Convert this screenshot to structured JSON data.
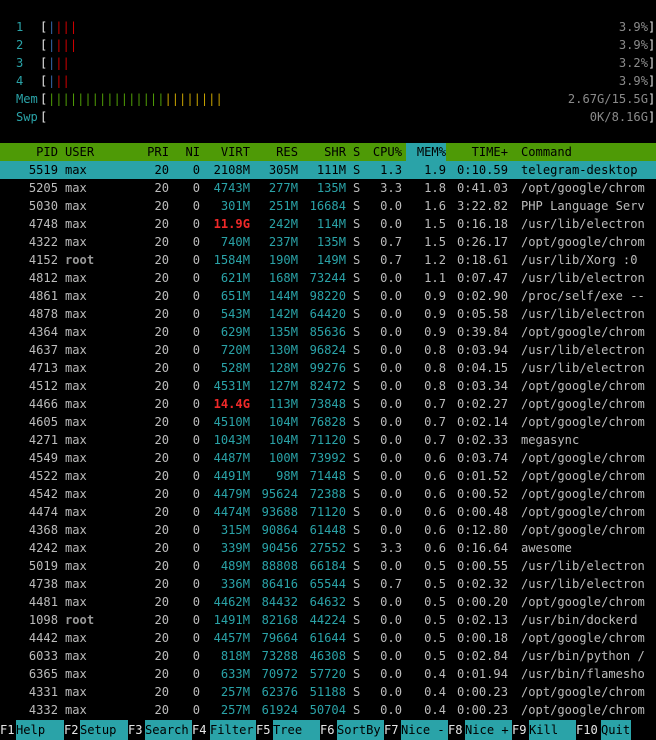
{
  "cpus": [
    {
      "label": "1",
      "percent": "3.9%",
      "low": "|",
      "normal": "|||"
    },
    {
      "label": "2",
      "percent": "3.9%",
      "low": "|",
      "normal": "|||"
    },
    {
      "label": "3",
      "percent": "3.2%",
      "low": "|",
      "normal": "||"
    },
    {
      "label": "4",
      "percent": "3.9%",
      "low": "|",
      "normal": "||"
    }
  ],
  "mem": {
    "label": "Mem",
    "value": "2.67G/15.5G",
    "used": "||||||||||||||||",
    "buffers": "",
    "cache": "||||||||"
  },
  "swp": {
    "label": "Swp",
    "value": "0K/8.16G"
  },
  "header": {
    "pid": "PID",
    "user": "USER",
    "pri": "PRI",
    "ni": "NI",
    "virt": "VIRT",
    "res": "RES",
    "shr": "SHR",
    "s": "S",
    "cpu": "CPU%",
    "mem": "MEM%",
    "time": "TIME+",
    "command": "Command"
  },
  "processes": [
    {
      "pid": "5519",
      "user": "max",
      "pri": "20",
      "ni": "0",
      "virt": "2108M",
      "res": "305M",
      "shr": "111M",
      "s": "S",
      "cpu": "1.3",
      "mem": "1.9",
      "time": "0:10.59",
      "command": "telegram-desktop",
      "selected": true
    },
    {
      "pid": "5205",
      "user": "max",
      "pri": "20",
      "ni": "0",
      "virt": "4743M",
      "res": "277M",
      "shr": "135M",
      "s": "S",
      "cpu": "3.3",
      "mem": "1.8",
      "time": "0:41.03",
      "command": "/opt/google/chrom"
    },
    {
      "pid": "5030",
      "user": "max",
      "pri": "20",
      "ni": "0",
      "virt": "301M",
      "res": "251M",
      "shr": "16684",
      "s": "S",
      "cpu": "0.0",
      "mem": "1.6",
      "time": "3:22.82",
      "command": "PHP Language Serv"
    },
    {
      "pid": "4748",
      "user": "max",
      "pri": "20",
      "ni": "0",
      "virt": "11.9G",
      "res": "242M",
      "shr": "114M",
      "s": "S",
      "cpu": "0.0",
      "mem": "1.5",
      "time": "0:16.18",
      "command": "/usr/lib/electron",
      "bigvirt": true
    },
    {
      "pid": "4322",
      "user": "max",
      "pri": "20",
      "ni": "0",
      "virt": "740M",
      "res": "237M",
      "shr": "135M",
      "s": "S",
      "cpu": "0.7",
      "mem": "1.5",
      "time": "0:26.17",
      "command": "/opt/google/chrom"
    },
    {
      "pid": "4152",
      "user": "root",
      "pri": "20",
      "ni": "0",
      "virt": "1584M",
      "res": "190M",
      "shr": "149M",
      "s": "S",
      "cpu": "0.7",
      "mem": "1.2",
      "time": "0:18.61",
      "command": "/usr/lib/Xorg :0"
    },
    {
      "pid": "4812",
      "user": "max",
      "pri": "20",
      "ni": "0",
      "virt": "621M",
      "res": "168M",
      "shr": "73244",
      "s": "S",
      "cpu": "0.0",
      "mem": "1.1",
      "time": "0:07.47",
      "command": "/usr/lib/electron"
    },
    {
      "pid": "4861",
      "user": "max",
      "pri": "20",
      "ni": "0",
      "virt": "651M",
      "res": "144M",
      "shr": "98220",
      "s": "S",
      "cpu": "0.0",
      "mem": "0.9",
      "time": "0:02.90",
      "command": "/proc/self/exe --"
    },
    {
      "pid": "4878",
      "user": "max",
      "pri": "20",
      "ni": "0",
      "virt": "543M",
      "res": "142M",
      "shr": "64420",
      "s": "S",
      "cpu": "0.0",
      "mem": "0.9",
      "time": "0:05.58",
      "command": "/usr/lib/electron"
    },
    {
      "pid": "4364",
      "user": "max",
      "pri": "20",
      "ni": "0",
      "virt": "629M",
      "res": "135M",
      "shr": "85636",
      "s": "S",
      "cpu": "0.0",
      "mem": "0.9",
      "time": "0:39.84",
      "command": "/opt/google/chrom"
    },
    {
      "pid": "4637",
      "user": "max",
      "pri": "20",
      "ni": "0",
      "virt": "720M",
      "res": "130M",
      "shr": "96824",
      "s": "S",
      "cpu": "0.0",
      "mem": "0.8",
      "time": "0:03.94",
      "command": "/usr/lib/electron"
    },
    {
      "pid": "4713",
      "user": "max",
      "pri": "20",
      "ni": "0",
      "virt": "528M",
      "res": "128M",
      "shr": "99276",
      "s": "S",
      "cpu": "0.0",
      "mem": "0.8",
      "time": "0:04.15",
      "command": "/usr/lib/electron"
    },
    {
      "pid": "4512",
      "user": "max",
      "pri": "20",
      "ni": "0",
      "virt": "4531M",
      "res": "127M",
      "shr": "82472",
      "s": "S",
      "cpu": "0.0",
      "mem": "0.8",
      "time": "0:03.34",
      "command": "/opt/google/chrom"
    },
    {
      "pid": "4466",
      "user": "max",
      "pri": "20",
      "ni": "0",
      "virt": "14.4G",
      "res": "113M",
      "shr": "73848",
      "s": "S",
      "cpu": "0.0",
      "mem": "0.7",
      "time": "0:02.27",
      "command": "/opt/google/chrom",
      "bigvirt": true
    },
    {
      "pid": "4605",
      "user": "max",
      "pri": "20",
      "ni": "0",
      "virt": "4510M",
      "res": "104M",
      "shr": "76828",
      "s": "S",
      "cpu": "0.0",
      "mem": "0.7",
      "time": "0:02.14",
      "command": "/opt/google/chrom"
    },
    {
      "pid": "4271",
      "user": "max",
      "pri": "20",
      "ni": "0",
      "virt": "1043M",
      "res": "104M",
      "shr": "71120",
      "s": "S",
      "cpu": "0.0",
      "mem": "0.7",
      "time": "0:02.33",
      "command": "megasync"
    },
    {
      "pid": "4549",
      "user": "max",
      "pri": "20",
      "ni": "0",
      "virt": "4487M",
      "res": "100M",
      "shr": "73992",
      "s": "S",
      "cpu": "0.0",
      "mem": "0.6",
      "time": "0:03.74",
      "command": "/opt/google/chrom"
    },
    {
      "pid": "4522",
      "user": "max",
      "pri": "20",
      "ni": "0",
      "virt": "4491M",
      "res": "98M",
      "shr": "71448",
      "s": "S",
      "cpu": "0.0",
      "mem": "0.6",
      "time": "0:01.52",
      "command": "/opt/google/chrom"
    },
    {
      "pid": "4542",
      "user": "max",
      "pri": "20",
      "ni": "0",
      "virt": "4479M",
      "res": "95624",
      "shr": "72388",
      "s": "S",
      "cpu": "0.0",
      "mem": "0.6",
      "time": "0:00.52",
      "command": "/opt/google/chrom"
    },
    {
      "pid": "4474",
      "user": "max",
      "pri": "20",
      "ni": "0",
      "virt": "4474M",
      "res": "93688",
      "shr": "71120",
      "s": "S",
      "cpu": "0.0",
      "mem": "0.6",
      "time": "0:00.48",
      "command": "/opt/google/chrom"
    },
    {
      "pid": "4368",
      "user": "max",
      "pri": "20",
      "ni": "0",
      "virt": "315M",
      "res": "90864",
      "shr": "61448",
      "s": "S",
      "cpu": "0.0",
      "mem": "0.6",
      "time": "0:12.80",
      "command": "/opt/google/chrom"
    },
    {
      "pid": "4242",
      "user": "max",
      "pri": "20",
      "ni": "0",
      "virt": "339M",
      "res": "90456",
      "shr": "27552",
      "s": "S",
      "cpu": "3.3",
      "mem": "0.6",
      "time": "0:16.64",
      "command": "awesome"
    },
    {
      "pid": "5019",
      "user": "max",
      "pri": "20",
      "ni": "0",
      "virt": "489M",
      "res": "88808",
      "shr": "66184",
      "s": "S",
      "cpu": "0.0",
      "mem": "0.5",
      "time": "0:00.55",
      "command": "/usr/lib/electron"
    },
    {
      "pid": "4738",
      "user": "max",
      "pri": "20",
      "ni": "0",
      "virt": "336M",
      "res": "86416",
      "shr": "65544",
      "s": "S",
      "cpu": "0.7",
      "mem": "0.5",
      "time": "0:02.32",
      "command": "/usr/lib/electron"
    },
    {
      "pid": "4481",
      "user": "max",
      "pri": "20",
      "ni": "0",
      "virt": "4462M",
      "res": "84432",
      "shr": "64632",
      "s": "S",
      "cpu": "0.0",
      "mem": "0.5",
      "time": "0:00.20",
      "command": "/opt/google/chrom"
    },
    {
      "pid": "1098",
      "user": "root",
      "pri": "20",
      "ni": "0",
      "virt": "1491M",
      "res": "82168",
      "shr": "44224",
      "s": "S",
      "cpu": "0.0",
      "mem": "0.5",
      "time": "0:02.13",
      "command": "/usr/bin/dockerd"
    },
    {
      "pid": "4442",
      "user": "max",
      "pri": "20",
      "ni": "0",
      "virt": "4457M",
      "res": "79664",
      "shr": "61644",
      "s": "S",
      "cpu": "0.0",
      "mem": "0.5",
      "time": "0:00.18",
      "command": "/opt/google/chrom"
    },
    {
      "pid": "6033",
      "user": "max",
      "pri": "20",
      "ni": "0",
      "virt": "818M",
      "res": "73288",
      "shr": "46308",
      "s": "S",
      "cpu": "0.0",
      "mem": "0.5",
      "time": "0:02.84",
      "command": "/usr/bin/python /"
    },
    {
      "pid": "6365",
      "user": "max",
      "pri": "20",
      "ni": "0",
      "virt": "633M",
      "res": "70972",
      "shr": "57720",
      "s": "S",
      "cpu": "0.0",
      "mem": "0.4",
      "time": "0:01.94",
      "command": "/usr/bin/flamesho"
    },
    {
      "pid": "4331",
      "user": "max",
      "pri": "20",
      "ni": "0",
      "virt": "257M",
      "res": "62376",
      "shr": "51188",
      "s": "S",
      "cpu": "0.0",
      "mem": "0.4",
      "time": "0:00.23",
      "command": "/opt/google/chrom"
    },
    {
      "pid": "4332",
      "user": "max",
      "pri": "20",
      "ni": "0",
      "virt": "257M",
      "res": "61924",
      "shr": "50704",
      "s": "S",
      "cpu": "0.0",
      "mem": "0.4",
      "time": "0:00.23",
      "command": "/opt/google/chrom"
    }
  ],
  "footer": [
    {
      "key": "F1",
      "label": "Help"
    },
    {
      "key": "F2",
      "label": "Setup"
    },
    {
      "key": "F3",
      "label": "Search"
    },
    {
      "key": "F4",
      "label": "Filter"
    },
    {
      "key": "F5",
      "label": "Tree"
    },
    {
      "key": "F6",
      "label": "SortBy"
    },
    {
      "key": "F7",
      "label": "Nice -"
    },
    {
      "key": "F8",
      "label": "Nice +"
    },
    {
      "key": "F9",
      "label": "Kill"
    },
    {
      "key": "F10",
      "label": "Quit"
    }
  ],
  "colors": {
    "accent": "#2aa3a8",
    "header": "#4e9a06",
    "hot": "#ef2929"
  }
}
